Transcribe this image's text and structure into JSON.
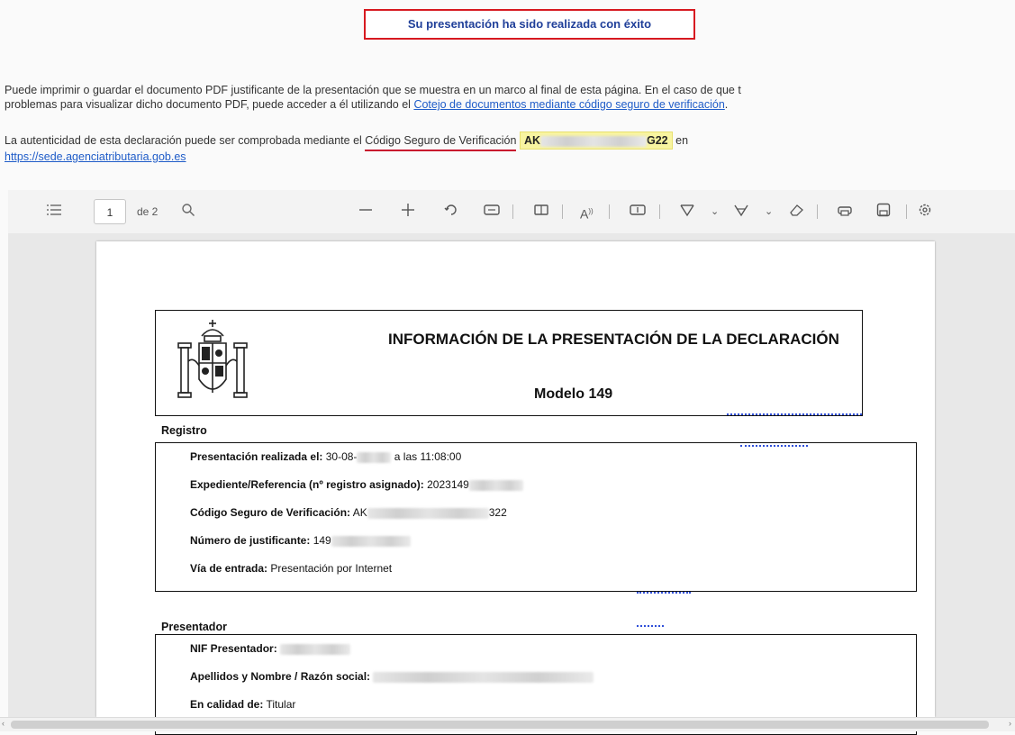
{
  "banner": {
    "text": "Su presentación ha sido realizada con éxito"
  },
  "intro": {
    "line1": "Puede imprimir o guardar el documento PDF justificante de la presentación que se muestra en un marco al final de esta página. En el caso de que t",
    "line2_prefix": "problemas para visualizar dicho documento PDF, puede acceder a él utilizando el ",
    "line2_link": "Cotejo de documentos mediante código seguro de verificación",
    "line2_suffix": "."
  },
  "auth": {
    "prefix": "La autenticidad de esta declaración puede ser comprobada mediante el ",
    "csv_label": "Código Seguro de Verificación",
    "csv_start": "AK",
    "csv_end": "G22",
    "suffix": " en",
    "url": "https://sede.agenciatributaria.gob.es"
  },
  "toolbar": {
    "menu_icon": "list-icon",
    "page_number": "1",
    "page_total": "de 2",
    "icons": [
      "search-icon",
      "zoom-out-icon",
      "zoom-in-icon",
      "rotate-icon",
      "fit-width-icon",
      "two-page-icon",
      "read-aloud-icon",
      "text-box-icon",
      "draw-icon",
      "highlight-icon",
      "eraser-icon",
      "print-icon",
      "save-icon",
      "settings-icon"
    ]
  },
  "document": {
    "title": "INFORMACIÓN DE LA PRESENTACIÓN DE LA DECLARACIÓN",
    "subtitle": "Modelo 149",
    "registro": {
      "heading": "Registro",
      "rows": [
        {
          "label": "Presentación realizada el:",
          "value": "30-08-",
          "value2": "a las 11:08:00"
        },
        {
          "label": "Expediente/Referencia (nº registro asignado):",
          "value": "2023149"
        },
        {
          "label": "Código Seguro de Verificación:",
          "value": "AK",
          "value2": "322"
        },
        {
          "label": "Número de justificante:",
          "value": "149"
        },
        {
          "label": "Vía de entrada:",
          "value": "Presentación por Internet"
        }
      ]
    },
    "presentador": {
      "heading": "Presentador",
      "rows": [
        {
          "label": "NIF Presentador:",
          "value": ""
        },
        {
          "label": "Apellidos y Nombre / Razón social:",
          "value": ""
        },
        {
          "label": "En calidad de:",
          "value": "Titular"
        }
      ]
    }
  },
  "colors": {
    "banner_border": "#d71920",
    "banner_text": "#1f3f99",
    "link": "#1f5cc8",
    "highlight": "#f8f4a0"
  }
}
